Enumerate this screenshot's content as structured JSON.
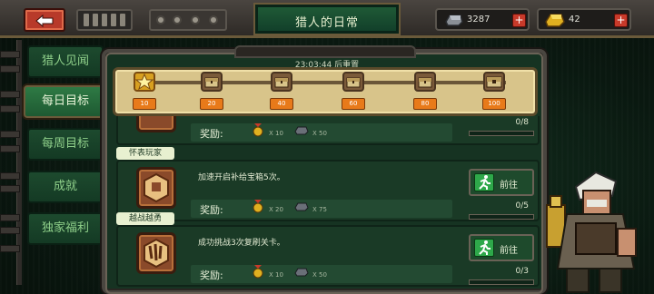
{
  "header": {
    "title": "猎人的日常",
    "currency_silver": "3287",
    "currency_gold": "42",
    "plus_label": "+"
  },
  "tabs": [
    {
      "label": "猎人见闻",
      "active": false
    },
    {
      "label": "每日目标",
      "active": true
    },
    {
      "label": "每周目标",
      "active": false
    },
    {
      "label": "成就",
      "active": false
    },
    {
      "label": "独家福利",
      "active": false
    }
  ],
  "reset": {
    "text": "23:03:44 后重置"
  },
  "milestones": [
    {
      "value": "10",
      "icon": "star-medal-icon"
    },
    {
      "value": "20",
      "icon": "chest-icon"
    },
    {
      "value": "40",
      "icon": "chest-icon"
    },
    {
      "value": "60",
      "icon": "chest-icon"
    },
    {
      "value": "80",
      "icon": "chest-icon"
    },
    {
      "value": "100",
      "icon": "big-chest-icon"
    }
  ],
  "progress_fraction": 0.05,
  "tasks": [
    {
      "name": "",
      "desc": "",
      "reward_label": "奖励:",
      "medal_qty": "X 10",
      "ingot_qty": "X 50",
      "progress": "0/8",
      "go_label": ""
    },
    {
      "name": "怀表玩家",
      "desc": "加速开启补给宝箱5次。",
      "reward_label": "奖励:",
      "medal_qty": "X 20",
      "ingot_qty": "X 75",
      "progress": "0/5",
      "go_label": "前往"
    },
    {
      "name": "越战越勇",
      "desc": "成功挑战3次复刷关卡。",
      "reward_label": "奖励:",
      "medal_qty": "X 10",
      "ingot_qty": "X 50",
      "progress": "0/3",
      "go_label": "前往"
    }
  ],
  "colors": {
    "accent": "#2ea84a",
    "badge": "#e87a1a",
    "plus": "#c83a2a"
  }
}
